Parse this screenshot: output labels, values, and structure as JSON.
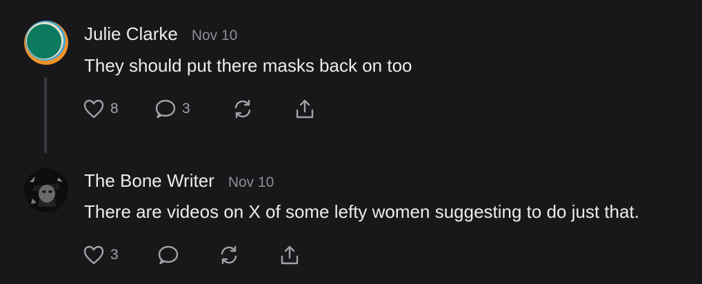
{
  "comments": [
    {
      "author": "Julie Clarke",
      "date": "Nov 10",
      "text": "They should put there masks back on too",
      "likes": "8",
      "replies": "3",
      "avatar_icon": "colorful-circle-avatar"
    },
    {
      "author": "The Bone Writer",
      "date": "Nov 10",
      "text": "There are videos on X of some lefty women suggesting to do just that.",
      "likes": "3",
      "avatar_icon": "black-and-white-photo-avatar"
    }
  ],
  "icons": {
    "like": "heart-icon",
    "reply": "speech-bubble-icon",
    "restack": "refresh-icon",
    "share": "share-icon"
  },
  "colors": {
    "background": "#18181b",
    "text": "#ececec",
    "muted": "#8d8d93",
    "icon": "#a3a3a8"
  }
}
